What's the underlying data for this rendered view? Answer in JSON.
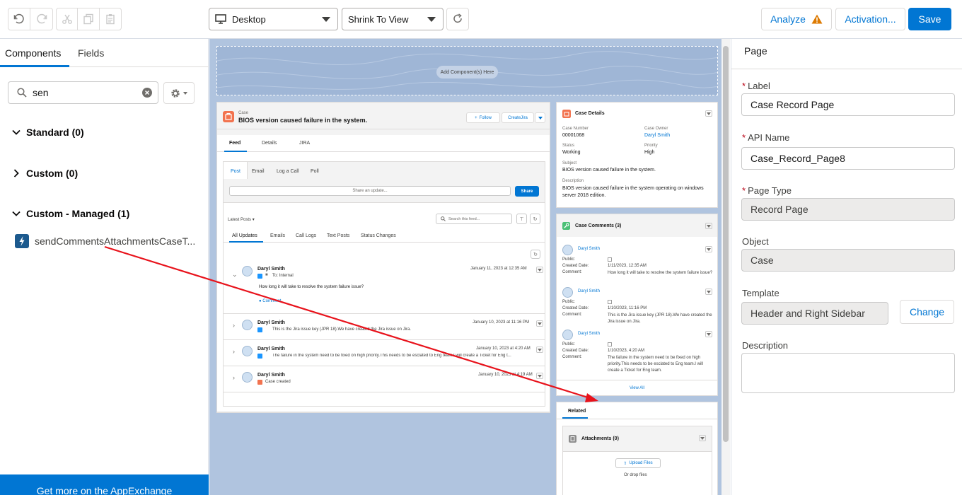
{
  "toolbar": {
    "undo_icon": "undo-icon",
    "redo_icon": "redo-icon",
    "cut_icon": "cut-icon",
    "copy_icon": "copy-icon",
    "paste_icon": "paste-icon",
    "device_select": "Desktop",
    "view_select": "Shrink To View",
    "analyze_label": "Analyze",
    "activation_label": "Activation...",
    "save_label": "Save",
    "accent_color": "#0176d3",
    "warning_color": "#dd7a01"
  },
  "left_panel": {
    "tabs": [
      {
        "label": "Components"
      },
      {
        "label": "Fields"
      }
    ],
    "search_value": "sen",
    "sections": [
      {
        "label": "Standard (0)"
      },
      {
        "label": "Custom (0)"
      },
      {
        "label": "Custom - Managed (1)"
      }
    ],
    "component_label": "sendCommentsAttachmentsCaseT...",
    "appexchange_label": "Get more on the AppExchange"
  },
  "canvas": {
    "add_components_label": "Add Component(s) Here",
    "record": {
      "object_label": "Case",
      "title": "BIOS version caused failure in the system.",
      "follow_label": "Follow",
      "createjira_label": "CreateJira",
      "tabs": [
        {
          "label": "Feed"
        },
        {
          "label": "Details"
        },
        {
          "label": "JIRA"
        }
      ],
      "publisher_tabs": [
        {
          "label": "Post"
        },
        {
          "label": "Email"
        },
        {
          "label": "Log a Call"
        },
        {
          "label": "Poll"
        }
      ],
      "share_placeholder": "Share an update...",
      "share_label": "Share",
      "latest_posts_label": "Latest Posts",
      "search_feed_placeholder": "Search this feed...",
      "filter_tabs": [
        {
          "label": "All Updates"
        },
        {
          "label": "Emails"
        },
        {
          "label": "Call Logs"
        },
        {
          "label": "Text Posts"
        },
        {
          "label": "Status Changes"
        }
      ],
      "feed_items": [
        {
          "author": "Daryl Smith",
          "sub": "To: Internal",
          "date": "January 11, 2023 at 12:35 AM",
          "body": "How long it will take to resolve the system failure issue?",
          "comment_label": "Comment"
        },
        {
          "author": "Daryl Smith",
          "sub": "This is the Jira issue key (JPR 18).We have created the Jira issue on Jira.",
          "date": "January 10, 2023 at 11:16 PM"
        },
        {
          "author": "Daryl Smith",
          "sub": "The failure in the system need to be fixed on high priority.This needs to be esclated to Eng team.I will create a Ticket for Eng t...",
          "date": "January 10, 2023 at 4:20 AM"
        },
        {
          "author": "Daryl Smith",
          "sub": "Case created",
          "date": "January 10, 2023 at 4:19 AM"
        }
      ]
    },
    "case_details": {
      "title": "Case Details",
      "case_number_label": "Case Number",
      "case_number": "00001068",
      "case_owner_label": "Case Owner",
      "case_owner": "Daryl Smith",
      "status_label": "Status",
      "status": "Working",
      "priority_label": "Priority",
      "priority": "High",
      "subject_label": "Subject",
      "subject": "BIOS version caused failure in the system.",
      "description_label": "Description",
      "description": "BIOS version caused failure in the system operating on windows server 2018 edition."
    },
    "case_comments": {
      "title": "Case Comments (3)",
      "public_label": "Public:",
      "created_label": "Created Date:",
      "comment_label": "Comment:",
      "items": [
        {
          "author": "Daryl Smith",
          "date": "1/11/2023, 12:35 AM",
          "comment": "How long it will take to resolve the system failure issue?"
        },
        {
          "author": "Daryl Smith",
          "date": "1/10/2023, 11:16 PM",
          "comment": "This is the Jira issue key (JPR 18).We have created the Jira issue on Jira."
        },
        {
          "author": "Daryl Smith",
          "date": "1/10/2023, 4:20 AM",
          "comment": "The failure in the system need to be fixed on high priority.This needs to be esclated to Eng team.I will create a Ticket for Eng team."
        }
      ],
      "view_all_label": "View All"
    },
    "related": {
      "tab_label": "Related",
      "attachments_title": "Attachments (0)",
      "upload_label": "Upload Files",
      "drop_label": "Or drop files"
    }
  },
  "right_panel": {
    "title": "Page",
    "label_label": "Label",
    "label_value": "Case Record Page",
    "api_name_label": "API Name",
    "api_name_value": "Case_Record_Page8",
    "page_type_label": "Page Type",
    "page_type_value": "Record Page",
    "object_label": "Object",
    "object_value": "Case",
    "template_label": "Template",
    "template_value": "Header and Right Sidebar",
    "change_label": "Change",
    "description_label": "Description",
    "description_value": ""
  }
}
